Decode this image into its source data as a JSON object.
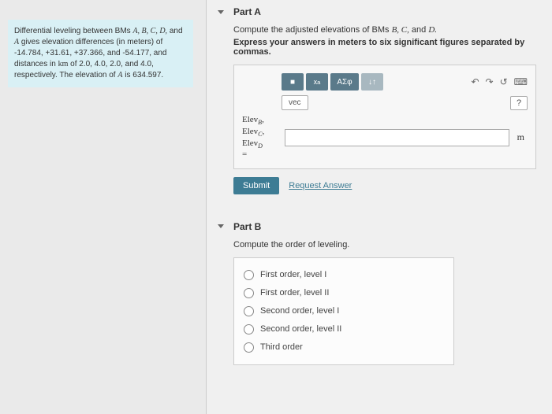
{
  "sidebar": {
    "problem_text_1": "Differential leveling between BMs ",
    "bm_list": "A, B, C, D,",
    "problem_text_2": " and ",
    "bm_a": "A",
    "problem_text_3": " gives elevation differences (in meters) of -14.784, +31.61, +37.366, and -54.177, and distances in ",
    "km": "km",
    "problem_text_4": " of 2.0, 4.0, 2.0, and 4.0, respectively. The elevation of ",
    "bm_a2": "A",
    "problem_text_5": " is 634.597."
  },
  "partA": {
    "title": "Part A",
    "prompt_1": "Compute the adjusted elevations of BMs ",
    "prompt_bms": "B, C,",
    "prompt_and": " and ",
    "prompt_d": "D.",
    "instruction": "Express your answers in meters to six significant figures separated by commas.",
    "tool_template": "■",
    "tool_root": "√",
    "tool_greek": "ΑΣφ",
    "tool_arrows": "↓↑",
    "vec_label": "vec",
    "undo": "↶",
    "redo": "↷",
    "reset": "↺",
    "keyboard": "⌨",
    "help": "?",
    "label_b": "Elev",
    "sub_b": "B",
    "label_c": "Elev",
    "sub_c": "C",
    "label_d": "Elev",
    "sub_d": "D",
    "equals": "=",
    "unit": "m",
    "answer_value": "",
    "submit": "Submit",
    "request": "Request Answer"
  },
  "partB": {
    "title": "Part B",
    "prompt": "Compute the order of leveling.",
    "options": [
      "First order, level I",
      "First order, level II",
      "Second order, level I",
      "Second order, level II",
      "Third order"
    ]
  }
}
